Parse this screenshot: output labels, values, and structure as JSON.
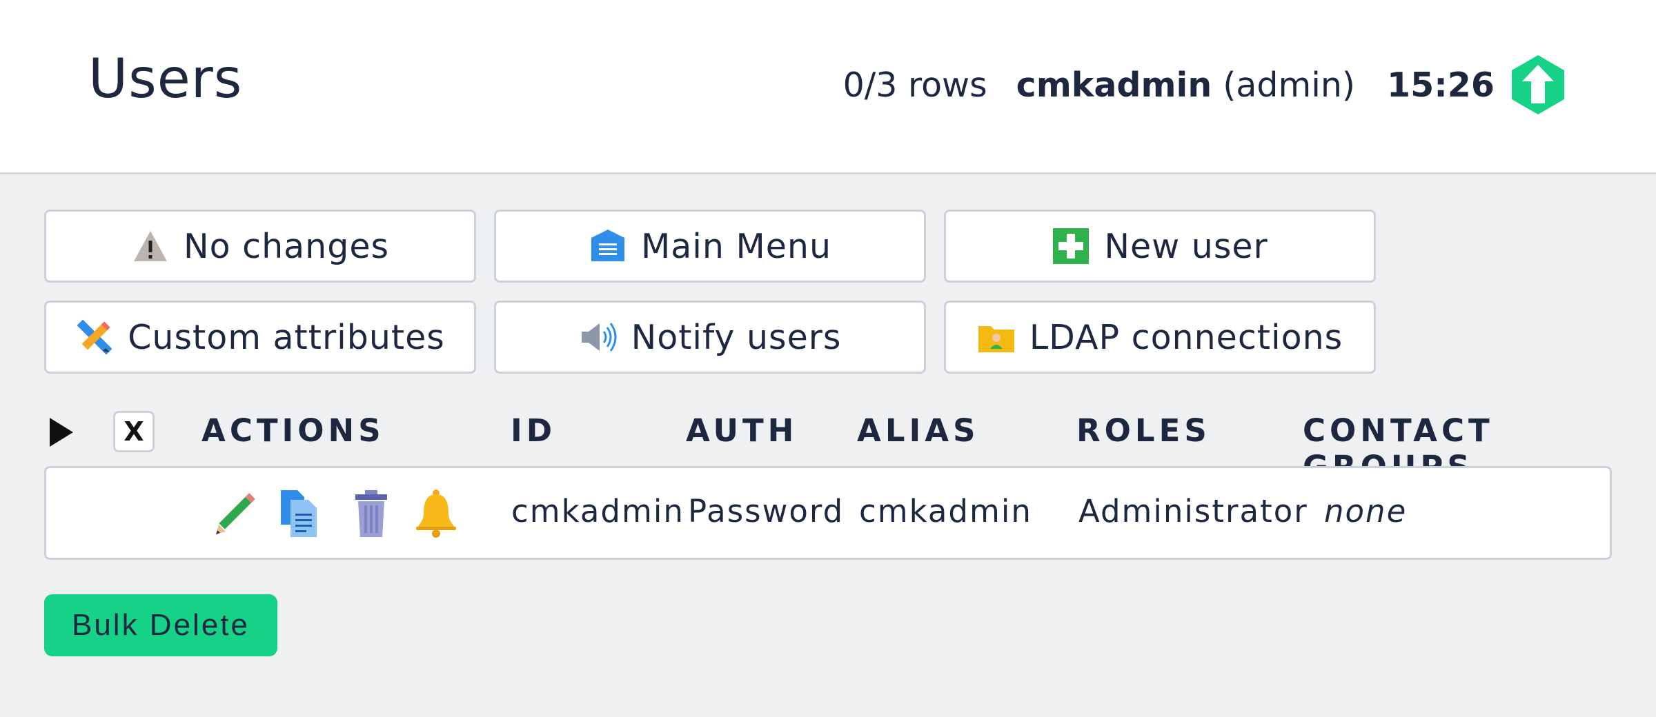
{
  "header": {
    "title": "Users",
    "rows_info": "0/3 rows",
    "user_name": "cmkadmin",
    "user_role": "(admin)",
    "clock": "15:26",
    "logo_icon": "checkmk-up-arrow-logo"
  },
  "actions": [
    {
      "label": "No changes",
      "icon": "warning-icon"
    },
    {
      "label": "Main Menu",
      "icon": "main-menu-icon"
    },
    {
      "label": "New user",
      "icon": "plus-icon"
    },
    {
      "label": "Custom attributes",
      "icon": "pencil-ruler-icon"
    },
    {
      "label": "Notify users",
      "icon": "speaker-icon"
    },
    {
      "label": "LDAP connections",
      "icon": "folder-user-icon"
    }
  ],
  "table": {
    "clear_label": "X",
    "columns": [
      "ACTIONS",
      "ID",
      "AUTH",
      "ALIAS",
      "ROLES",
      "CONTACT GROUPS"
    ],
    "rows": [
      {
        "action_icons": [
          "edit-pencil-icon",
          "clone-document-icon",
          "delete-trash-icon",
          "notification-bell-icon"
        ],
        "id": "cmkadmin",
        "auth": "Password",
        "alias": "cmkadmin",
        "roles": "Administrator",
        "contact_groups": "none"
      }
    ]
  },
  "bulk_delete_label": "Bulk Delete",
  "colors": {
    "background": "#eff0f2",
    "text": "#1e2740",
    "accent_green": "#15d287",
    "border": "#ccd0d8"
  }
}
